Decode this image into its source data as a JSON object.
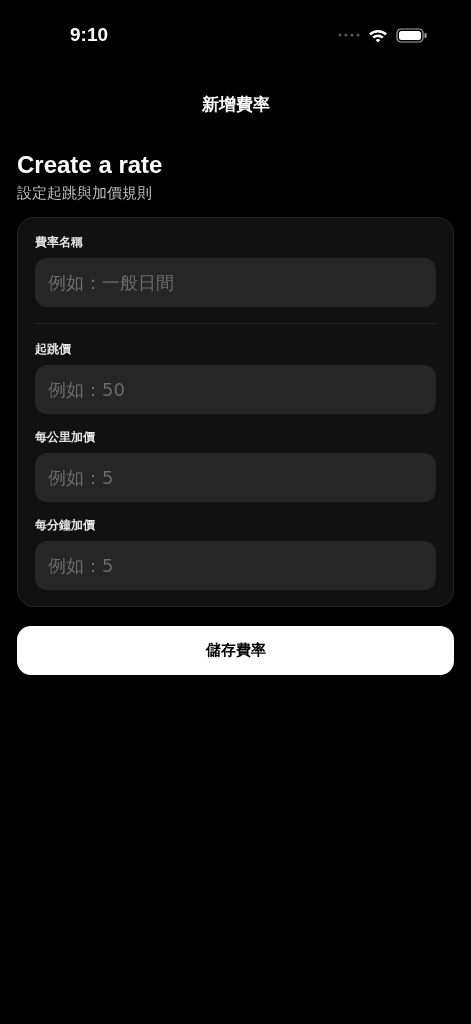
{
  "status_bar": {
    "time": "9:10"
  },
  "nav": {
    "title": "新增費率"
  },
  "header": {
    "title": "Create a rate",
    "subtitle": "設定起跳與加價規則"
  },
  "form": {
    "groups": [
      [
        {
          "label": "費率名稱",
          "placeholder": "例如：一般日間"
        }
      ],
      [
        {
          "label": "起跳價",
          "placeholder": "例如：50"
        },
        {
          "label": "每公里加價",
          "placeholder": "例如：5"
        },
        {
          "label": "每分鐘加價",
          "placeholder": "例如：5"
        }
      ]
    ]
  },
  "save_button": {
    "label": "儲存費率"
  }
}
